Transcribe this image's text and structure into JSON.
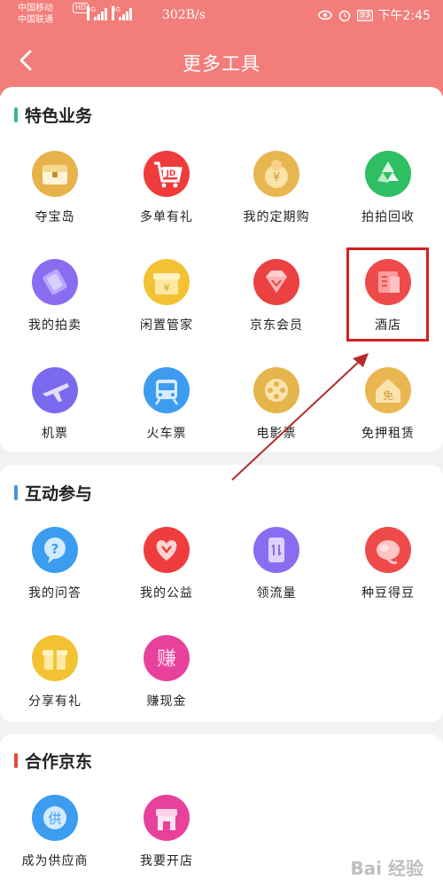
{
  "status_bar": {
    "carrier1": "中国移动",
    "carrier2": "中国联通",
    "hd": "HD",
    "net1": "4G",
    "net2": "4G",
    "speed": "302B/s",
    "battery": "93",
    "time": "下午2:45"
  },
  "header": {
    "title": "更多工具",
    "back_icon": "chevron-left-icon"
  },
  "sections": [
    {
      "title": "特色业务",
      "accent": "#3cb98a",
      "items": [
        {
          "label": "夺宝岛",
          "icon": "treasure-chest-icon",
          "color": "#e7b24a"
        },
        {
          "label": "多单有礼",
          "icon": "jd-cart-icon",
          "color": "#ef3b3b"
        },
        {
          "label": "我的定期购",
          "icon": "coin-bag-icon",
          "color": "#e8b650"
        },
        {
          "label": "拍拍回收",
          "icon": "recycle-icon",
          "color": "#2fbf63"
        },
        {
          "label": "我的拍卖",
          "icon": "auction-gavel-icon",
          "color": "#8a6cf0"
        },
        {
          "label": "闲置管家",
          "icon": "gift-box-icon",
          "color": "#f3c233"
        },
        {
          "label": "京东会员",
          "icon": "diamond-icon",
          "color": "#ec4141"
        },
        {
          "label": "酒店",
          "icon": "hotel-building-icon",
          "color": "#ef4a4a"
        },
        {
          "label": "机票",
          "icon": "airplane-icon",
          "color": "#7b6af0"
        },
        {
          "label": "火车票",
          "icon": "train-icon",
          "color": "#3d9bf0"
        },
        {
          "label": "电影票",
          "icon": "film-reel-icon",
          "color": "#e4b54b"
        },
        {
          "label": "免押租赁",
          "icon": "house-deposit-icon",
          "color": "#e9b650"
        }
      ]
    },
    {
      "title": "互动参与",
      "accent": "#4a90e2",
      "items": [
        {
          "label": "我的问答",
          "icon": "question-bubble-icon",
          "color": "#3b9cf0"
        },
        {
          "label": "我的公益",
          "icon": "heart-icon",
          "color": "#ef3d3d"
        },
        {
          "label": "领流量",
          "icon": "phone-data-icon",
          "color": "#8a6cf0"
        },
        {
          "label": "种豆得豆",
          "icon": "bean-icon",
          "color": "#ef4a4a"
        },
        {
          "label": "分享有礼",
          "icon": "share-gift-icon",
          "color": "#f3c233"
        },
        {
          "label": "赚现金",
          "icon": "earn-cash-icon",
          "color": "#e8419c",
          "glyph": "赚"
        }
      ]
    },
    {
      "title": "合作京东",
      "accent": "#e84a3b",
      "items": [
        {
          "label": "成为供应商",
          "icon": "supplier-icon",
          "color": "#3b9cf0",
          "glyph": "供"
        },
        {
          "label": "我要开店",
          "icon": "storefront-icon",
          "color": "#e8419c"
        }
      ]
    }
  ],
  "watermark": "Bai 经验"
}
